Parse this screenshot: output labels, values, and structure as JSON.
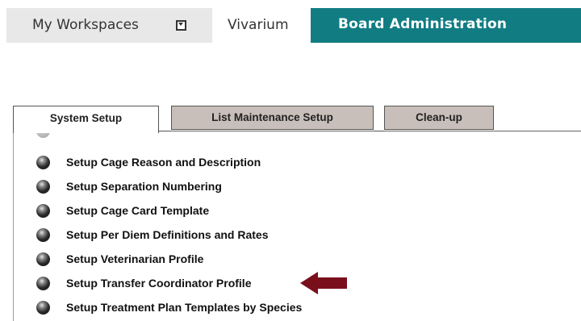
{
  "topnav": {
    "workspaces_label": "My Workspaces",
    "vivarium_label": "Vivarium",
    "board_label": "Board Administration",
    "board_color": "#117d83"
  },
  "tabs": [
    {
      "label": "System Setup",
      "active": true
    },
    {
      "label": "List Maintenance Setup",
      "active": false
    },
    {
      "label": "Clean-up",
      "active": false
    }
  ],
  "setup_items": [
    {
      "label": "Setup Cage Reason and Description"
    },
    {
      "label": "Setup Separation Numbering"
    },
    {
      "label": "Setup Cage Card Template"
    },
    {
      "label": "Setup Per Diem Definitions and Rates"
    },
    {
      "label": "Setup Veterinarian Profile"
    },
    {
      "label": "Setup Transfer Coordinator Profile",
      "highlighted": true
    },
    {
      "label": "Setup Treatment Plan Templates by Species"
    }
  ],
  "icons": {
    "dropdown": "chevron-down-icon",
    "bullet": "bullet-icon",
    "pointer": "arrow-left-icon"
  },
  "accent_colors": {
    "arrow": "#7a0f1c",
    "inactive_tab": "#c8bfba"
  }
}
